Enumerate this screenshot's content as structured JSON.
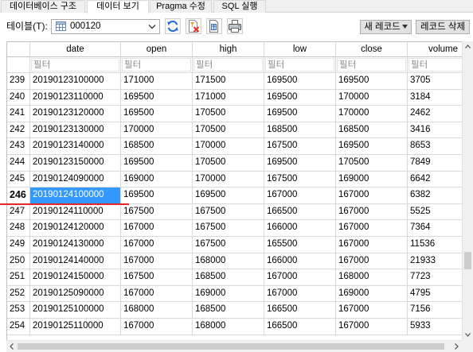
{
  "tabs": [
    {
      "label": "데이터베이스 구조"
    },
    {
      "label": "데이터 보기"
    },
    {
      "label": "Pragma 수정"
    },
    {
      "label": "SQL 실행"
    }
  ],
  "active_tab_index": 1,
  "toolbar": {
    "table_label": "테이블(T):",
    "table_value": "000120",
    "icons": {
      "table": "table-icon",
      "refresh": "refresh-icon",
      "clear_filters": "clear-filters-icon",
      "save": "save-table-icon",
      "print": "print-icon"
    },
    "new_record_label": "새 레코드",
    "delete_record_label": "레코드 삭제"
  },
  "table": {
    "columns": [
      "date",
      "open",
      "high",
      "low",
      "close",
      "volume"
    ],
    "filter_placeholder": "필터",
    "selected_row": "246",
    "selected_column": "date",
    "rows": [
      {
        "id": "239",
        "cells": [
          "20190123100000",
          "171000",
          "171500",
          "169500",
          "169500",
          "3705"
        ]
      },
      {
        "id": "240",
        "cells": [
          "20190123110000",
          "169500",
          "171000",
          "169500",
          "170000",
          "3184"
        ]
      },
      {
        "id": "241",
        "cells": [
          "20190123120000",
          "169500",
          "170500",
          "169500",
          "170000",
          "2462"
        ]
      },
      {
        "id": "242",
        "cells": [
          "20190123130000",
          "170000",
          "170500",
          "168500",
          "168500",
          "3416"
        ]
      },
      {
        "id": "243",
        "cells": [
          "20190123140000",
          "168500",
          "170000",
          "167500",
          "169500",
          "8653"
        ]
      },
      {
        "id": "244",
        "cells": [
          "20190123150000",
          "169500",
          "170500",
          "169500",
          "170500",
          "7849"
        ]
      },
      {
        "id": "245",
        "cells": [
          "20190124090000",
          "169000",
          "170000",
          "167500",
          "169000",
          "6642"
        ]
      },
      {
        "id": "246",
        "cells": [
          "20190124100000",
          "169500",
          "169500",
          "167000",
          "167000",
          "6382"
        ]
      },
      {
        "id": "247",
        "cells": [
          "20190124110000",
          "167500",
          "167500",
          "166500",
          "167000",
          "5525"
        ]
      },
      {
        "id": "248",
        "cells": [
          "20190124120000",
          "167000",
          "167500",
          "166000",
          "167000",
          "7364"
        ]
      },
      {
        "id": "249",
        "cells": [
          "20190124130000",
          "167000",
          "167500",
          "165500",
          "167000",
          "11536"
        ]
      },
      {
        "id": "250",
        "cells": [
          "20190124140000",
          "167000",
          "168000",
          "166000",
          "167000",
          "21933"
        ]
      },
      {
        "id": "251",
        "cells": [
          "20190124150000",
          "167500",
          "168500",
          "167000",
          "168000",
          "7723"
        ]
      },
      {
        "id": "252",
        "cells": [
          "20190125090000",
          "167000",
          "169000",
          "167000",
          "169000",
          "4795"
        ]
      },
      {
        "id": "253",
        "cells": [
          "20190125100000",
          "168000",
          "168500",
          "166500",
          "167000",
          "7156"
        ]
      },
      {
        "id": "254",
        "cells": [
          "20190125110000",
          "167000",
          "168000",
          "166500",
          "167000",
          "5933"
        ]
      }
    ]
  },
  "scrollbars": {
    "vertical_level": 0.77,
    "horizontal_level": 0
  },
  "colors": {
    "selection": "#3399ff",
    "selection_text": "#ffffff",
    "annotation_underline": "#e3262b",
    "grid_line": "#d9d9d9"
  }
}
